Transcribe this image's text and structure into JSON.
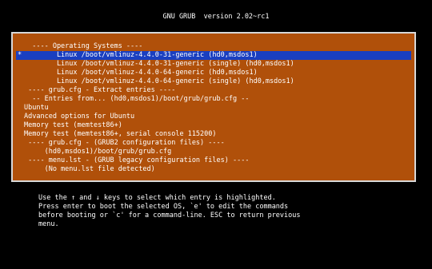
{
  "header": {
    "title": "GNU GRUB  version 2.02~rc1"
  },
  "colors": {
    "frame_bg": "#b0500a",
    "selected_bg": "#1a3fc0",
    "screen_bg": "#000000"
  },
  "menu": {
    "marker": "*",
    "items": [
      {
        "label": "---- Operating Systems ----",
        "indent": 2,
        "selected": false
      },
      {
        "label": "Linux /boot/vmlinuz-4.4.0-31-generic (hd0,msdos1)",
        "indent": 8,
        "selected": true
      },
      {
        "label": "Linux /boot/vmlinuz-4.4.0-31-generic (single) (hd0,msdos1)",
        "indent": 8,
        "selected": false
      },
      {
        "label": "Linux /boot/vmlinuz-4.4.0-64-generic (hd0,msdos1)",
        "indent": 8,
        "selected": false
      },
      {
        "label": "Linux /boot/vmlinuz-4.4.0-64-generic (single) (hd0,msdos1)",
        "indent": 8,
        "selected": false
      },
      {
        "label": "---- grub.cfg - Extract entries ----",
        "indent": 1,
        "selected": false
      },
      {
        "label": "-- Entries from... (hd0,msdos1)/boot/grub/grub.cfg --",
        "indent": 2,
        "selected": false
      },
      {
        "label": "Ubuntu",
        "indent": 0,
        "selected": false
      },
      {
        "label": "Advanced options for Ubuntu",
        "indent": 0,
        "selected": false
      },
      {
        "label": "Memory test (memtest86+)",
        "indent": 0,
        "selected": false
      },
      {
        "label": "Memory test (memtest86+, serial console 115200)",
        "indent": 0,
        "selected": false
      },
      {
        "label": "---- grub.cfg - (GRUB2 configuration files) ----",
        "indent": 1,
        "selected": false
      },
      {
        "label": "(hd0,msdos1)/boot/grub/grub.cfg",
        "indent": 5,
        "selected": false
      },
      {
        "label": "---- menu.lst - (GRUB legacy configuration files) ----",
        "indent": 1,
        "selected": false
      },
      {
        "label": "(No menu.lst file detected)",
        "indent": 5,
        "selected": false
      }
    ]
  },
  "help": {
    "lines": [
      "Use the ↑ and ↓ keys to select which entry is highlighted.",
      "Press enter to boot the selected OS, `e' to edit the commands",
      "before booting or `c' for a command-line. ESC to return previous",
      "menu."
    ]
  }
}
